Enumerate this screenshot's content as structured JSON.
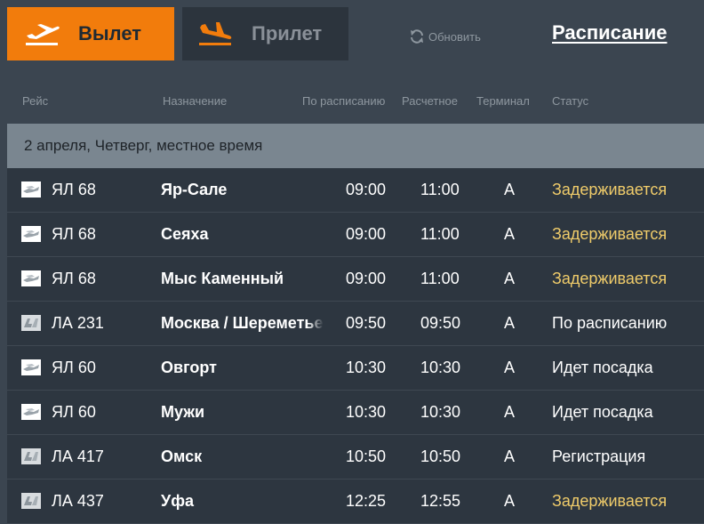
{
  "tabs": {
    "departures": "Вылет",
    "arrivals": "Прилет"
  },
  "refresh_label": "Обновить",
  "schedule_link": "Расписание",
  "columns": {
    "flight": "Рейс",
    "destination": "Назначение",
    "scheduled": "По расписанию",
    "estimated": "Расчетное",
    "terminal": "Терминал",
    "status": "Статус"
  },
  "date_label": "2 апреля, Четверг, местное время",
  "colors": {
    "accent": "#f27c0c",
    "delayed": "#f0cc6a"
  },
  "rows": [
    {
      "flight": "ЯЛ 68",
      "destination": "Яр-Сале",
      "scheduled": "09:00",
      "estimated": "11:00",
      "terminal": "A",
      "status": "Задерживается",
      "delayed": true,
      "airline_logo": "yamal-logo-icon"
    },
    {
      "flight": "ЯЛ 68",
      "destination": "Сеяха",
      "scheduled": "09:00",
      "estimated": "11:00",
      "terminal": "A",
      "status": "Задерживается",
      "delayed": true,
      "airline_logo": "yamal-logo-icon"
    },
    {
      "flight": "ЯЛ 68",
      "destination": "Мыс Каменный",
      "scheduled": "09:00",
      "estimated": "11:00",
      "terminal": "A",
      "status": "Задерживается",
      "delayed": true,
      "airline_logo": "yamal-logo-icon"
    },
    {
      "flight": "ЛА 231",
      "destination": "Москва / Шереметьево",
      "scheduled": "09:50",
      "estimated": "09:50",
      "terminal": "A",
      "status": "По расписанию",
      "delayed": false,
      "airline_logo": "la-logo-icon"
    },
    {
      "flight": "ЯЛ 60",
      "destination": "Овгорт",
      "scheduled": "10:30",
      "estimated": "10:30",
      "terminal": "A",
      "status": "Идет посадка",
      "delayed": false,
      "airline_logo": "yamal-logo-icon"
    },
    {
      "flight": "ЯЛ 60",
      "destination": "Мужи",
      "scheduled": "10:30",
      "estimated": "10:30",
      "terminal": "A",
      "status": "Идет посадка",
      "delayed": false,
      "airline_logo": "yamal-logo-icon"
    },
    {
      "flight": "ЛА 417",
      "destination": "Омск",
      "scheduled": "10:50",
      "estimated": "10:50",
      "terminal": "A",
      "status": "Регистрация",
      "delayed": false,
      "airline_logo": "la-logo-icon"
    },
    {
      "flight": "ЛА 437",
      "destination": "Уфа",
      "scheduled": "12:25",
      "estimated": "12:55",
      "terminal": "A",
      "status": "Задерживается",
      "delayed": true,
      "airline_logo": "la-logo-icon"
    }
  ]
}
